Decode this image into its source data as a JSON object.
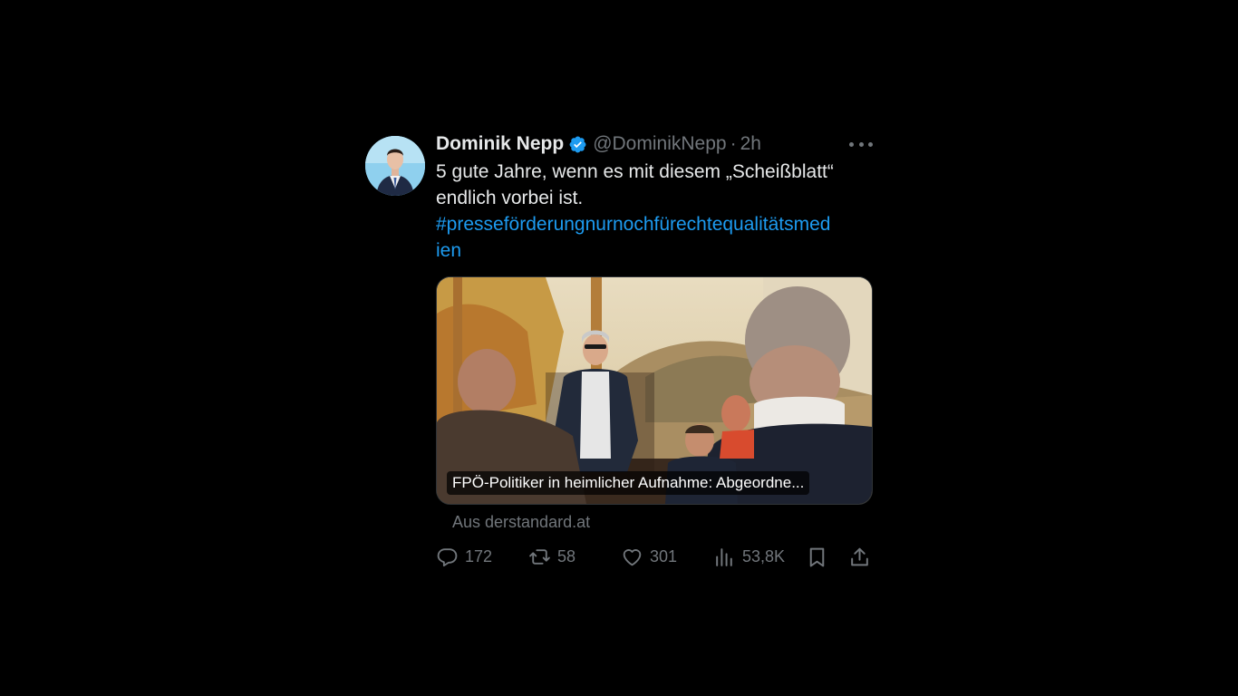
{
  "tweet": {
    "author_name": "Dominik Nepp",
    "handle": "@DominikNepp",
    "separator": "·",
    "time": "2h",
    "text_line1": "5 gute Jahre, wenn es mit diesem „Scheißblatt“",
    "text_line2": "endlich vorbei ist.",
    "hashtag_line1": "#presseförderungnurnochfürechtequalitätsmed",
    "hashtag_line2": "ien",
    "card_caption": "FPÖ-Politiker in heimlicher Aufnahme: Abgeordne...",
    "card_source": "Aus derstandard.at",
    "stats": {
      "replies": "172",
      "reposts": "58",
      "likes": "301",
      "views": "53,8K"
    }
  },
  "colors": {
    "background": "#000000",
    "text": "#e7e9ea",
    "muted": "#71767b",
    "link": "#1d9bf0",
    "verified_badge": "#1d9bf0"
  },
  "icons": {
    "more": "more-horizontal-icon",
    "reply": "reply-icon",
    "repost": "repost-icon",
    "like": "heart-icon",
    "views": "views-chart-icon",
    "bookmark": "bookmark-icon",
    "share": "share-icon",
    "verified": "verified-badge-icon"
  }
}
